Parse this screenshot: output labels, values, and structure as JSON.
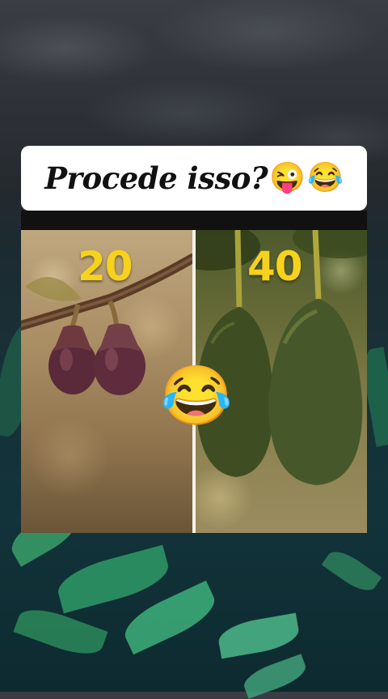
{
  "caption": {
    "text": "Procede isso?",
    "emoji_1": "😜",
    "emoji_2": "😂"
  },
  "comparison": {
    "left_number": "20",
    "right_number": "40",
    "center_emoji": "😂"
  },
  "colors": {
    "number_yellow": "#f7d21c",
    "fig_purple": "#5a2a3a",
    "avocado_green": "#3e4d22"
  }
}
